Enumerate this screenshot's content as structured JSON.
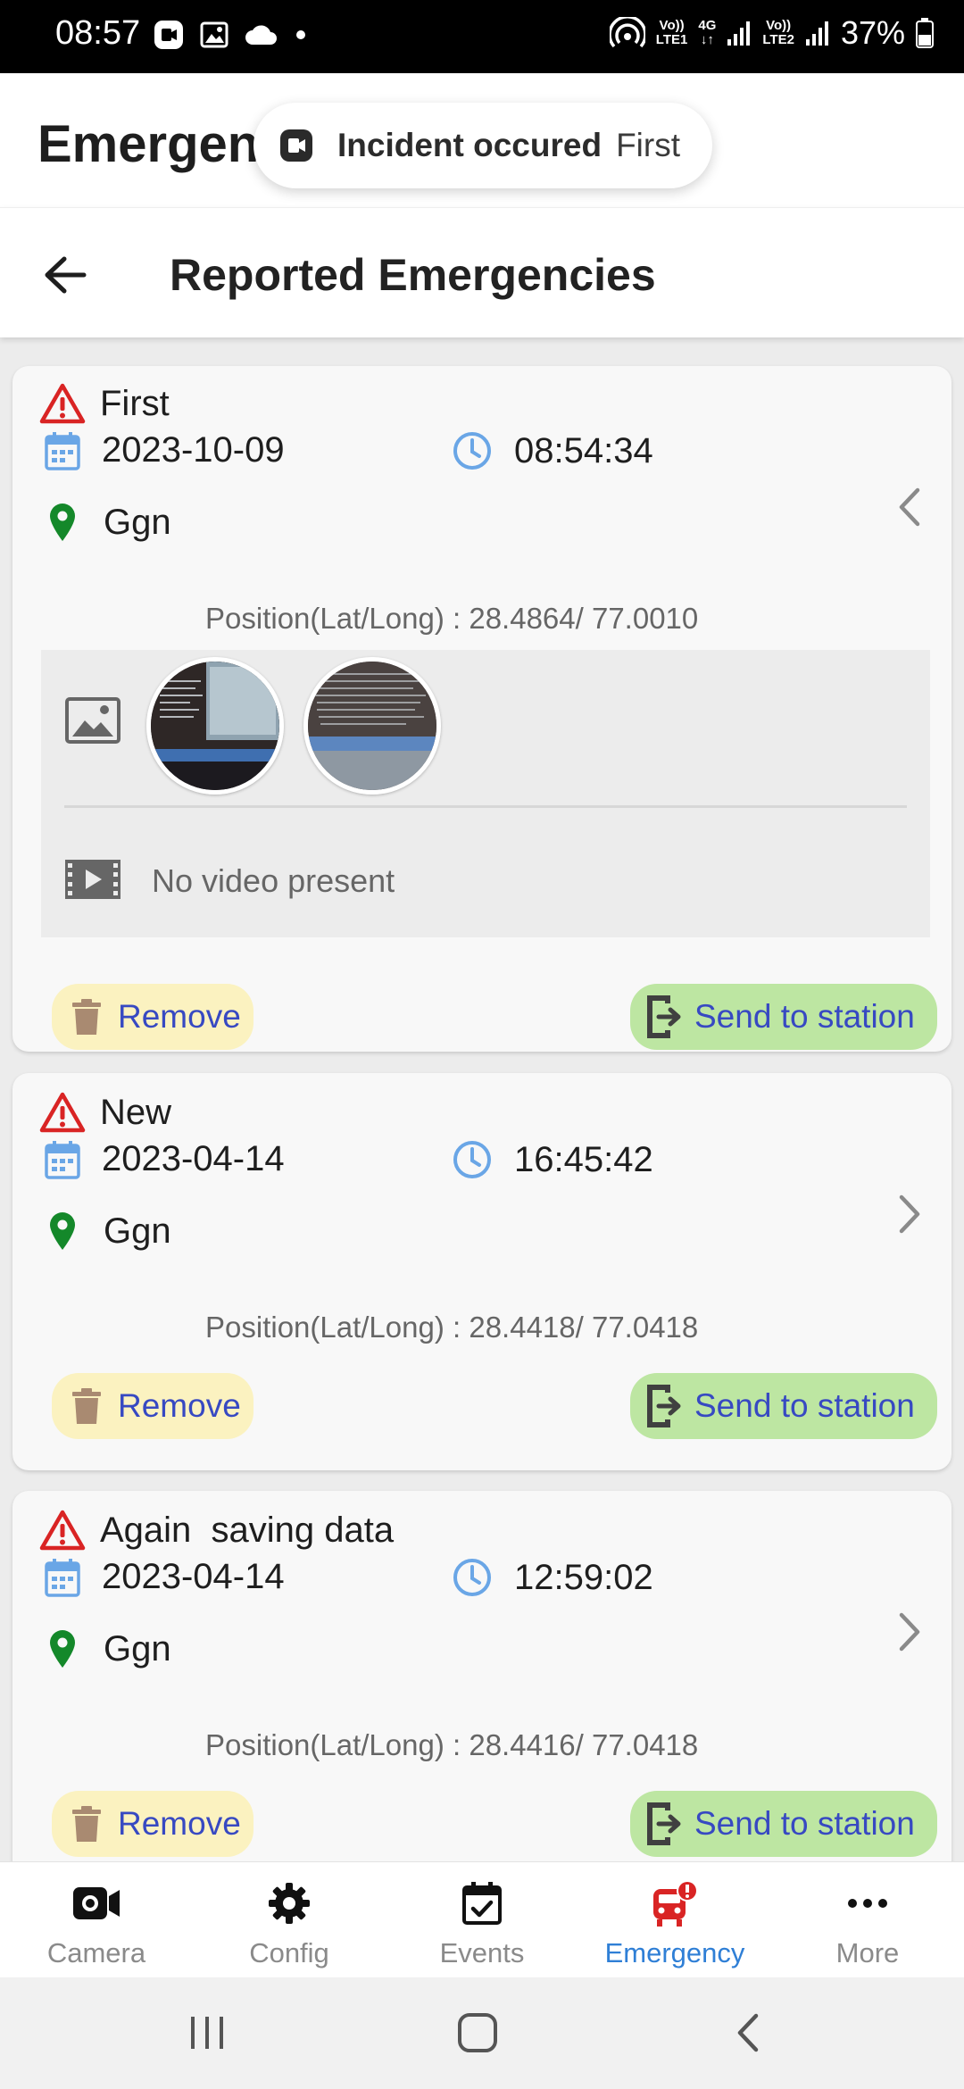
{
  "status_bar": {
    "time": "08:57",
    "network_1_top": "Vo))",
    "network_1_bottom": "LTE1",
    "network_type": "4G",
    "network_2_top": "Vo))",
    "network_2_bottom": "LTE2",
    "battery": "37%"
  },
  "app_header": {
    "title": "Emergency"
  },
  "toast": {
    "title": "Incident occured",
    "message": "First"
  },
  "sub_header": {
    "title": "Reported Emergencies"
  },
  "emergencies": [
    {
      "title": "First",
      "date": "2023-10-09",
      "time": "08:54:34",
      "location": "Ggn",
      "position": "Position(Lat/Long) : 28.4864/ 77.0010",
      "expanded": true,
      "no_video_text": "No video present",
      "remove_label": "Remove",
      "send_label": "Send to station"
    },
    {
      "title": "New",
      "date": "2023-04-14",
      "time": "16:45:42",
      "location": "Ggn",
      "position": "Position(Lat/Long) : 28.4418/ 77.0418",
      "expanded": false,
      "remove_label": "Remove",
      "send_label": "Send to station"
    },
    {
      "title": "Again  saving data",
      "date": "2023-04-14",
      "time": "12:59:02",
      "location": "Ggn",
      "position": "Position(Lat/Long) : 28.4416/ 77.0418",
      "expanded": false,
      "remove_label": "Remove",
      "send_label": "Send to station"
    }
  ],
  "bottom_nav": [
    {
      "label": "Camera",
      "icon": "camera-icon",
      "active": false
    },
    {
      "label": "Config",
      "icon": "gear-icon",
      "active": false
    },
    {
      "label": "Events",
      "icon": "calendar-check-icon",
      "active": false
    },
    {
      "label": "Emergency",
      "icon": "emergency-vehicle-icon",
      "active": true
    },
    {
      "label": "More",
      "icon": "more-dots-icon",
      "active": false
    }
  ],
  "colors": {
    "warning_red": "#d92424",
    "calendar_blue": "#6aa6e6",
    "location_green": "#14882a",
    "remove_bg": "#fbf2c0",
    "send_bg": "#bde6a2",
    "button_text": "#3749c2",
    "active_nav": "#2f7fd6"
  }
}
